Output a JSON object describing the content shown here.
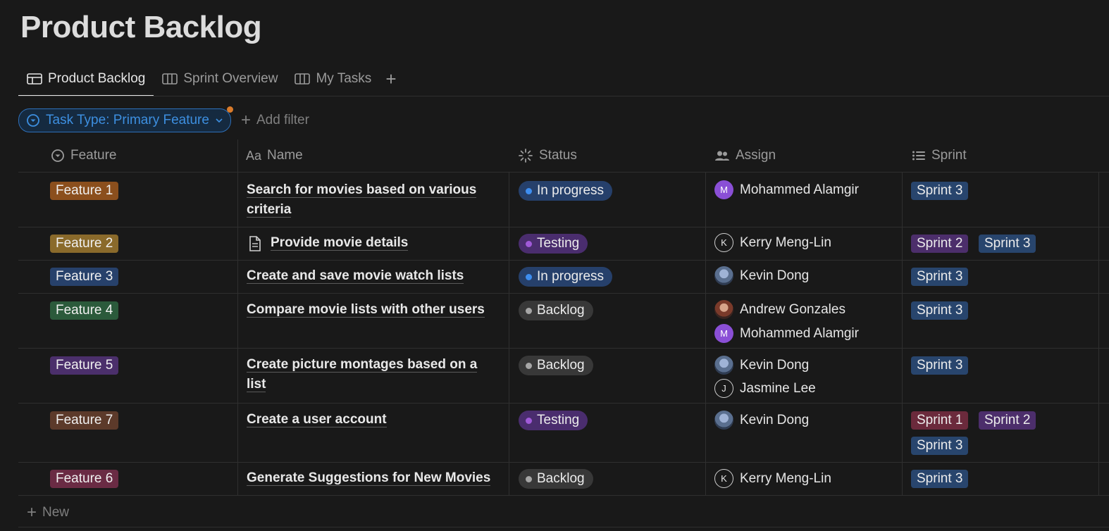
{
  "page": {
    "title": "Product Backlog"
  },
  "tabs": [
    {
      "label": "Product Backlog",
      "icon": "table-icon",
      "active": true
    },
    {
      "label": "Sprint Overview",
      "icon": "board-icon",
      "active": false
    },
    {
      "label": "My Tasks",
      "icon": "board-icon",
      "active": false
    }
  ],
  "filters": {
    "active_filter_label": "Task Type: Primary Feature",
    "add_filter_label": "Add filter"
  },
  "columns": [
    {
      "label": "Feature",
      "icon": "select-icon"
    },
    {
      "label": "Name",
      "icon": "text-icon",
      "icon_text": "Aa"
    },
    {
      "label": "Status",
      "icon": "status-icon"
    },
    {
      "label": "Assign",
      "icon": "people-icon"
    },
    {
      "label": "Sprint",
      "icon": "list-icon"
    }
  ],
  "colors": {
    "feature_orange": "#8b4f1d",
    "feature_brown_yellow": "#8a6a2b",
    "feature_blue": "#27416b",
    "feature_green": "#2b5a3b",
    "feature_purple": "#4b2f6b",
    "feature_brown": "#5c3a2a",
    "feature_pink": "#6a2b44",
    "status_blue_bg": "#26406b",
    "status_blue_dot": "#3e8ef0",
    "status_purple_bg": "#4a2d6e",
    "status_purple_dot": "#a05ad8",
    "status_gray_bg": "#383838",
    "status_gray_dot": "#a6a6a6",
    "sprint_blue": "#28456d",
    "sprint_purple": "#4c2e6b",
    "sprint_red": "#6b2a3c"
  },
  "rows": [
    {
      "feature": "Feature 1",
      "name": [
        "Search for movies based on various",
        "criteria"
      ],
      "status": "In progress",
      "assignees": [
        "Mohammed Alamgir"
      ],
      "sprints": [
        "Sprint 3"
      ]
    },
    {
      "feature": "Feature 2",
      "name": [
        "Provide movie details"
      ],
      "has_doc_icon": true,
      "status": "Testing",
      "assignees": [
        "Kerry Meng-Lin"
      ],
      "sprints": [
        "Sprint 2",
        "Sprint 3"
      ]
    },
    {
      "feature": "Feature 3",
      "name": [
        "Create and save movie watch lists"
      ],
      "status": "In progress",
      "assignees": [
        "Kevin Dong"
      ],
      "sprints": [
        "Sprint 3"
      ]
    },
    {
      "feature": "Feature 4",
      "name": [
        "Compare movie lists with other users"
      ],
      "status": "Backlog",
      "assignees": [
        "Andrew Gonzales",
        "Mohammed Alamgir"
      ],
      "sprints": [
        "Sprint 3"
      ]
    },
    {
      "feature": "Feature 5",
      "name": [
        "Create picture montages based on a",
        "list"
      ],
      "status": "Backlog",
      "assignees": [
        "Kevin Dong",
        "Jasmine Lee"
      ],
      "sprints": [
        "Sprint 3"
      ]
    },
    {
      "feature": "Feature 7",
      "name": [
        "Create a user account"
      ],
      "status": "Testing",
      "assignees": [
        "Kevin Dong"
      ],
      "sprints": [
        "Sprint 1",
        "Sprint 2",
        "Sprint 3"
      ]
    },
    {
      "feature": "Feature 6",
      "name": [
        "Generate Suggestions for New Movies"
      ],
      "status": "Backlog",
      "assignees": [
        "Kerry Meng-Lin"
      ],
      "sprints": [
        "Sprint 3"
      ]
    }
  ],
  "avatar_letters": {
    "mohammed": "M",
    "kerry": "K",
    "jasmine": "J"
  },
  "new_row_label": "New"
}
